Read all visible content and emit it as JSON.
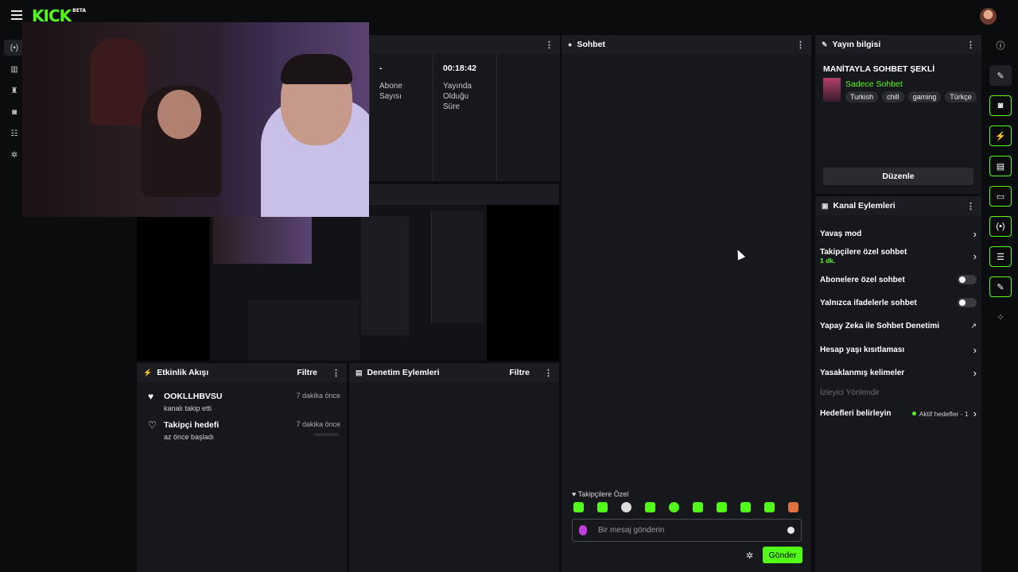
{
  "brand": {
    "logo": "KICK",
    "badge": "BETA"
  },
  "stats": [
    {
      "value": "-",
      "label": "Abone Sayısı"
    },
    {
      "value": "00:18:42",
      "label": "Yayında Olduğu Süre"
    }
  ],
  "chat": {
    "title": "Sohbet",
    "followers_only_label": "Takipçilere Özel",
    "input_placeholder": "Bir mesaj gönderin",
    "send_label": "Gönder"
  },
  "stream_info": {
    "title": "Yayın bilgisi",
    "stream_title": "MANİTAYLA SOHBET ŞEKLİ",
    "category": "Sadece Sohbet",
    "tags": [
      "Turkish",
      "chill",
      "gaming",
      "Türkçe"
    ],
    "edit_label": "Düzenle"
  },
  "channel_actions": {
    "title": "Kanal Eylemleri",
    "slow_mode": "Yavaş mod",
    "followers_only": "Takipçilere özel sohbet",
    "followers_only_duration": "1 dk.",
    "subscribers_only": "Abonelere özel sohbet",
    "emotes_only": "Yalnızca ifadelerle sohbet",
    "ai_moderation": "Yapay Zeka ile Sohbet Denetimi",
    "account_age": "Hesap yaşı kısıtlaması",
    "banned_words": "Yasaklanmış kelimeler",
    "raid": "İzleyici Yönlendir",
    "goals": "Hedefleri belirleyin",
    "goals_status": "Aktif hedefler - 1"
  },
  "activity": {
    "title": "Etkinlik Akışı",
    "filter_label": "Filtre",
    "events": [
      {
        "title": "OOKLLHBVSU",
        "subtitle": "kanalı takip etti",
        "time": "7 dakika önce"
      },
      {
        "title": "Takipçi hedefi",
        "subtitle": "az önce başladı",
        "time": "7 dakika önce"
      }
    ]
  },
  "moderation": {
    "title": "Denetim Eylemleri",
    "filter_label": "Filtre"
  },
  "colors": {
    "accent": "#53fc18",
    "panel": "#17181c",
    "background": "#0b0c0e"
  }
}
